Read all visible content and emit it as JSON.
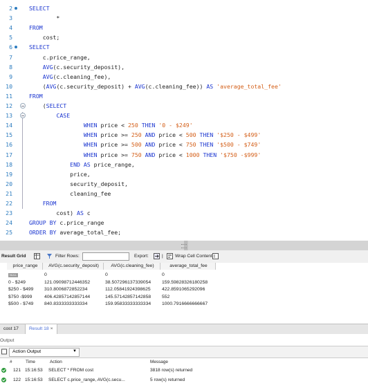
{
  "editor": {
    "lines": [
      {
        "num": "2",
        "marker": true,
        "segs": [
          [
            "kw",
            "SELECT"
          ]
        ]
      },
      {
        "num": "3",
        "segs": [
          [
            "id",
            "        *"
          ]
        ]
      },
      {
        "num": "4",
        "segs": [
          [
            "kw",
            "FROM"
          ]
        ]
      },
      {
        "num": "5",
        "segs": [
          [
            "id",
            "    cost;"
          ]
        ]
      },
      {
        "num": "6",
        "marker": true,
        "segs": [
          [
            "kw",
            "SELECT"
          ]
        ]
      },
      {
        "num": "7",
        "segs": [
          [
            "id",
            "    c.price_range,"
          ]
        ]
      },
      {
        "num": "8",
        "segs": [
          [
            "id",
            "    "
          ],
          [
            "kw",
            "AVG"
          ],
          [
            "id",
            "(c.security_deposit),"
          ]
        ]
      },
      {
        "num": "9",
        "segs": [
          [
            "id",
            "    "
          ],
          [
            "kw",
            "AVG"
          ],
          [
            "id",
            "(c.cleaning_fee),"
          ]
        ]
      },
      {
        "num": "10",
        "segs": [
          [
            "id",
            "    ("
          ],
          [
            "kw",
            "AVG"
          ],
          [
            "id",
            "(c.security_deposit) + "
          ],
          [
            "kw",
            "AVG"
          ],
          [
            "id",
            "(c.cleaning_fee)) "
          ],
          [
            "kw",
            "AS"
          ],
          [
            "id",
            " "
          ],
          [
            "str",
            "'average_total_fee'"
          ]
        ]
      },
      {
        "num": "11",
        "segs": [
          [
            "kw",
            "FROM"
          ]
        ]
      },
      {
        "num": "12",
        "fold": true,
        "segs": [
          [
            "id",
            "    ("
          ],
          [
            "kw",
            "SELECT"
          ]
        ]
      },
      {
        "num": "13",
        "fold": true,
        "segs": [
          [
            "id",
            "        "
          ],
          [
            "kw",
            "CASE"
          ]
        ]
      },
      {
        "num": "14",
        "segs": [
          [
            "id",
            "                "
          ],
          [
            "kw",
            "WHEN"
          ],
          [
            "id",
            " price < "
          ],
          [
            "num",
            "250"
          ],
          [
            "id",
            " "
          ],
          [
            "kw",
            "THEN"
          ],
          [
            "id",
            " "
          ],
          [
            "str",
            "'0 - $249'"
          ]
        ]
      },
      {
        "num": "15",
        "segs": [
          [
            "id",
            "                "
          ],
          [
            "kw",
            "WHEN"
          ],
          [
            "id",
            " price >= "
          ],
          [
            "num",
            "250"
          ],
          [
            "id",
            " "
          ],
          [
            "kw",
            "AND"
          ],
          [
            "id",
            " price < "
          ],
          [
            "num",
            "500"
          ],
          [
            "id",
            " "
          ],
          [
            "kw",
            "THEN"
          ],
          [
            "id",
            " "
          ],
          [
            "str",
            "'$250 - $499'"
          ]
        ]
      },
      {
        "num": "16",
        "segs": [
          [
            "id",
            "                "
          ],
          [
            "kw",
            "WHEN"
          ],
          [
            "id",
            " price >= "
          ],
          [
            "num",
            "500"
          ],
          [
            "id",
            " "
          ],
          [
            "kw",
            "AND"
          ],
          [
            "id",
            " price < "
          ],
          [
            "num",
            "750"
          ],
          [
            "id",
            " "
          ],
          [
            "kw",
            "THEN"
          ],
          [
            "id",
            " "
          ],
          [
            "str",
            "'$500 - $749'"
          ]
        ]
      },
      {
        "num": "17",
        "segs": [
          [
            "id",
            "                "
          ],
          [
            "kw",
            "WHEN"
          ],
          [
            "id",
            " price >= "
          ],
          [
            "num",
            "750"
          ],
          [
            "id",
            " "
          ],
          [
            "kw",
            "AND"
          ],
          [
            "id",
            " price < "
          ],
          [
            "num",
            "1000"
          ],
          [
            "id",
            " "
          ],
          [
            "kw",
            "THEN"
          ],
          [
            "id",
            " "
          ],
          [
            "str",
            "'$750 -$999'"
          ]
        ]
      },
      {
        "num": "18",
        "segs": [
          [
            "id",
            "            "
          ],
          [
            "kw",
            "END AS"
          ],
          [
            "id",
            " price_range,"
          ]
        ]
      },
      {
        "num": "19",
        "segs": [
          [
            "id",
            "            price,"
          ]
        ]
      },
      {
        "num": "20",
        "segs": [
          [
            "id",
            "            security_deposit,"
          ]
        ]
      },
      {
        "num": "21",
        "segs": [
          [
            "id",
            "            cleaning_fee"
          ]
        ]
      },
      {
        "num": "22",
        "segs": [
          [
            "id",
            "    "
          ],
          [
            "kw",
            "FROM"
          ]
        ]
      },
      {
        "num": "23",
        "segs": [
          [
            "id",
            "        cost) "
          ],
          [
            "kw",
            "AS"
          ],
          [
            "id",
            " c"
          ]
        ]
      },
      {
        "num": "24",
        "segs": [
          [
            "kw",
            "GROUP BY"
          ],
          [
            "id",
            " c.price_range"
          ]
        ]
      },
      {
        "num": "25",
        "segs": [
          [
            "kw",
            "ORDER BY"
          ],
          [
            "id",
            " average_total_fee;"
          ]
        ]
      }
    ]
  },
  "toolbar": {
    "result_grid": "Result Grid",
    "filter_rows": "Filter Rows:",
    "export": "Export:",
    "wrap": "Wrap Cell Content:"
  },
  "grid": {
    "columns": [
      "price_range",
      "AVG(c.security_deposit)",
      "AVG(c.cleaning_fee)",
      "average_total_fee"
    ],
    "null_label": "NULL",
    "rows": [
      [
        "",
        "0",
        "0",
        "0"
      ],
      [
        "0 - $249",
        "121.09098712446352",
        "38.507296137339054",
        "159.59828326180258"
      ],
      [
        "$250 - $499",
        "310.8006872852234",
        "112.05841924398625",
        "422.8591065292096"
      ],
      [
        "$750 -$999",
        "406.42857142857144",
        "145.57142857142858",
        "552"
      ],
      [
        "$500 - $749",
        "840.8333333333334",
        "159.95833333333334",
        "1000.7916666666667"
      ]
    ]
  },
  "tabs": {
    "tab1": "cost 17",
    "tab2": "Result 18",
    "close": "×"
  },
  "output": {
    "header": "Output",
    "selector": "Action Output",
    "cols": {
      "num": "#",
      "time": "Time",
      "action": "Action",
      "message": "Message"
    },
    "rows": [
      {
        "num": "121",
        "time": "15:16:53",
        "action": "SELECT   * FROM   cost",
        "message": "3818 row(s) returned"
      },
      {
        "num": "122",
        "time": "15:16:53",
        "action": "SELECT   c.price_range,   AVG(c.secu...",
        "message": "5 row(s) returned"
      }
    ]
  },
  "colors": {
    "keyword": "#1a35d0",
    "string": "#d4601a",
    "line_number": "#2b7bbf",
    "active_tab": "#4a6fd8",
    "success": "#2c9a3a"
  }
}
